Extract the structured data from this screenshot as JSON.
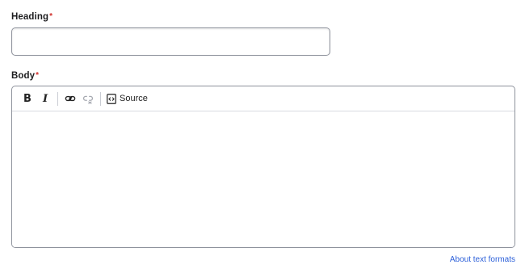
{
  "heading_field": {
    "label": "Heading",
    "required_marker": "*",
    "value": "",
    "placeholder": ""
  },
  "body_field": {
    "label": "Body",
    "required_marker": "*",
    "toolbar": {
      "bold_label": "B",
      "italic_label": "I",
      "link_icon": "link-icon",
      "unlink_icon": "unlink-icon",
      "source_icon": "source-code-icon",
      "source_label": "Source"
    },
    "content": ""
  },
  "help_link": {
    "label": "About text formats"
  },
  "colors": {
    "required": "#d0312d",
    "link": "#2b5fd9",
    "border": "#8e929c",
    "disabled_icon": "#a5a8b0"
  }
}
